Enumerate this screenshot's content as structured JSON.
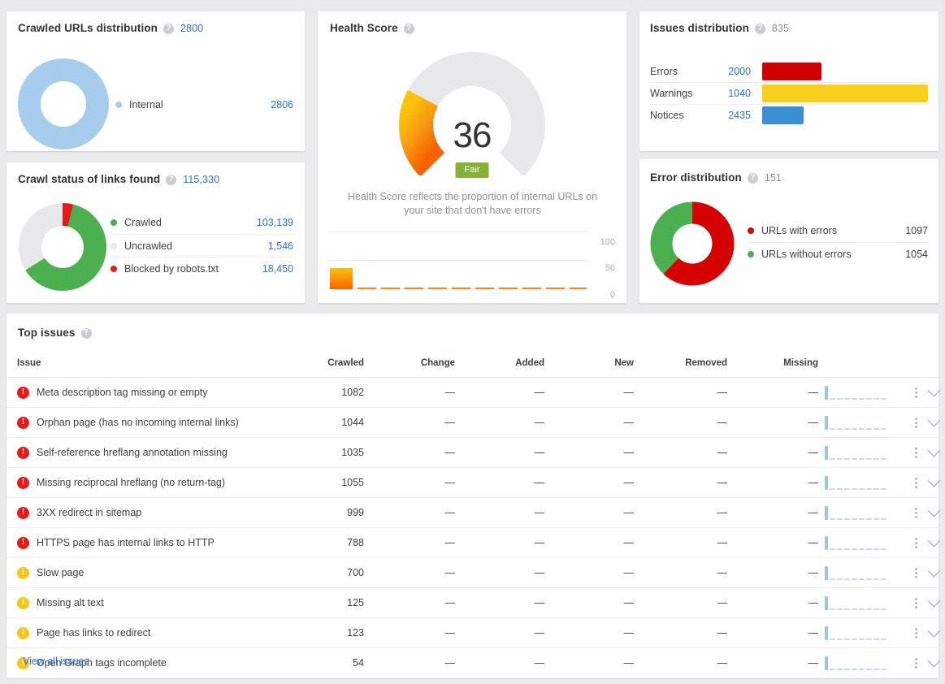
{
  "cards": {
    "crawled_urls": {
      "title": "Crawled URLs distribution",
      "help_icon": "help-icon",
      "total": "2800",
      "legend": [
        {
          "label": "Internal",
          "value": "2806",
          "color": "#a8cdec"
        }
      ]
    },
    "crawl_status": {
      "title": "Crawl status of links found",
      "help_icon": "help-icon",
      "total": "115,330",
      "legend": [
        {
          "label": "Crawled",
          "value": "103,139",
          "color": "#4caf50"
        },
        {
          "label": "Uncrawled",
          "value": "1,546",
          "color": "#e6e8ea"
        },
        {
          "label": "Blocked by robots.txt",
          "value": "18,450",
          "color": "#e21b1b"
        }
      ]
    },
    "health_score": {
      "title": "Health Score",
      "help_icon": "help-icon",
      "score": "36",
      "badge": "Fair",
      "badge_color": "#85b235",
      "description": "Health Score reflects the proportion of internal URLs on your site that don't have errors",
      "axis_labels": [
        "100",
        "50",
        "0"
      ]
    },
    "issues_distribution": {
      "title": "Issues distribution",
      "help_icon": "help-icon",
      "total": "835",
      "rows": [
        {
          "label": "Errors",
          "value": "2000",
          "color": "#d00000",
          "width_pct": 36
        },
        {
          "label": "Warnings",
          "value": "1040",
          "color": "#f7cf1c",
          "width_pct": 100
        },
        {
          "label": "Notices",
          "value": "2435",
          "color": "#3b8fd4",
          "width_pct": 25
        }
      ]
    },
    "error_distribution": {
      "title": "Error distribution",
      "help_icon": "help-icon",
      "total": "151",
      "legend": [
        {
          "label": "URLs with errors",
          "value": "1097",
          "color": "#d50000"
        },
        {
          "label": "URLs without errors",
          "value": "1054",
          "color": "#4caf50"
        }
      ]
    },
    "top_issues": {
      "title": "Top issues",
      "help_icon": "help-icon",
      "columns": [
        "Issue",
        "Crawled",
        "Change",
        "Added",
        "New",
        "Removed",
        "Missing"
      ],
      "empty_value": "—",
      "rows": [
        {
          "severity": "error",
          "icon": "error-icon",
          "issue": "Meta description tag missing or empty",
          "crawled": "1082",
          "change": "—",
          "added": "—",
          "new": "—",
          "removed": "—",
          "missing": "—"
        },
        {
          "severity": "error",
          "icon": "error-icon",
          "issue": "Orphan page (has no incoming internal links)",
          "crawled": "1044",
          "change": "—",
          "added": "—",
          "new": "—",
          "removed": "—",
          "missing": "—"
        },
        {
          "severity": "error",
          "icon": "error-icon",
          "issue": "Self-reference hreflang annotation missing",
          "crawled": "1035",
          "change": "—",
          "added": "—",
          "new": "—",
          "removed": "—",
          "missing": "—"
        },
        {
          "severity": "error",
          "icon": "error-icon",
          "issue": "Missing reciprocal hreflang (no return-tag)",
          "crawled": "1055",
          "change": "—",
          "added": "—",
          "new": "—",
          "removed": "—",
          "missing": "—"
        },
        {
          "severity": "error",
          "icon": "error-icon",
          "issue": "3XX redirect in sitemap",
          "crawled": "999",
          "change": "—",
          "added": "—",
          "new": "—",
          "removed": "—",
          "missing": "—"
        },
        {
          "severity": "error",
          "icon": "error-icon",
          "issue": "HTTPS page has internal links to HTTP",
          "crawled": "788",
          "change": "—",
          "added": "—",
          "new": "—",
          "removed": "—",
          "missing": "—"
        },
        {
          "severity": "warn",
          "icon": "info-icon",
          "issue": "Slow page",
          "crawled": "700",
          "change": "—",
          "added": "—",
          "new": "—",
          "removed": "—",
          "missing": "—"
        },
        {
          "severity": "warn",
          "icon": "info-icon",
          "issue": "Missing alt text",
          "crawled": "125",
          "change": "—",
          "added": "—",
          "new": "—",
          "removed": "—",
          "missing": "—"
        },
        {
          "severity": "warn",
          "icon": "info-icon",
          "issue": "Page has links to redirect",
          "crawled": "123",
          "change": "—",
          "added": "—",
          "new": "—",
          "removed": "—",
          "missing": "—"
        },
        {
          "severity": "warn",
          "icon": "info-icon",
          "issue": "Open Graph tags incomplete",
          "crawled": "54",
          "change": "—",
          "added": "—",
          "new": "—",
          "removed": "—",
          "missing": "—"
        }
      ],
      "view_all_label": "View all issues"
    }
  },
  "chart_data": [
    {
      "type": "pie",
      "title": "Crawled URLs distribution",
      "labels": [
        "Internal"
      ],
      "values": [
        2806
      ],
      "colors": [
        "#a8cdec"
      ],
      "donut": true,
      "legend_position": "right"
    },
    {
      "type": "pie",
      "title": "Crawl status of links found",
      "labels": [
        "Crawled",
        "Uncrawled",
        "Blocked by robots.txt"
      ],
      "values": [
        103139,
        1546,
        18450
      ],
      "display_fractions": [
        0.62,
        0.34,
        0.04
      ],
      "colors": [
        "#4caf50",
        "#e6e8ea",
        "#e21b1b"
      ],
      "donut": true,
      "legend_position": "right"
    },
    {
      "type": "bar",
      "title": "Health Score",
      "categories": [
        "1",
        "2",
        "3",
        "4",
        "5",
        "6",
        "7",
        "8",
        "9",
        "10",
        "11"
      ],
      "values": [
        36,
        0,
        0,
        0,
        0,
        0,
        0,
        0,
        0,
        0,
        0
      ],
      "ylim": [
        0,
        100
      ],
      "ytick_labels": [
        "0",
        "50",
        "100"
      ],
      "ylabel": "",
      "xlabel": "",
      "grid": true,
      "colors": [
        "#f79a12"
      ]
    },
    {
      "type": "bar",
      "title": "Issues distribution",
      "categories": [
        "Errors",
        "Warnings",
        "Notices"
      ],
      "values": [
        2000,
        1040,
        2435
      ],
      "bar_display_fractions": [
        0.36,
        1.0,
        0.25
      ],
      "colors": [
        "#d00000",
        "#f7cf1c",
        "#3b8fd4"
      ],
      "orientation": "horizontal"
    },
    {
      "type": "pie",
      "title": "Error distribution",
      "labels": [
        "URLs with errors",
        "URLs without errors"
      ],
      "values": [
        1097,
        1054
      ],
      "display_fractions": [
        0.62,
        0.38
      ],
      "colors": [
        "#d50000",
        "#4caf50"
      ],
      "donut": true,
      "legend_position": "right"
    }
  ]
}
